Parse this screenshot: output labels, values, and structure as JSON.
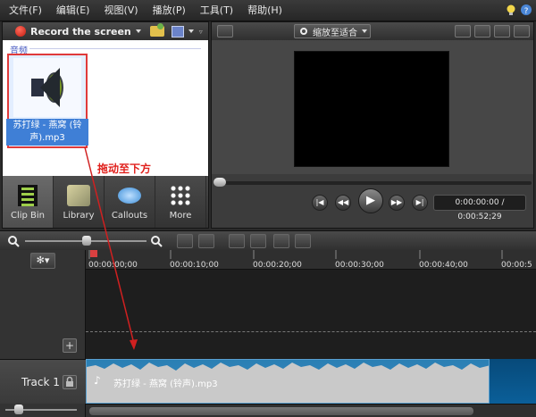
{
  "menu": [
    "文件(F)",
    "编辑(E)",
    "视图(V)",
    "播放(P)",
    "工具(T)",
    "帮助(H)"
  ],
  "clip_bin": {
    "record_label": "Record the screen",
    "section_label": "音频",
    "clip_name": "苏打绿 - 燕窝 (铃声).mp3",
    "tabs": [
      "Clip Bin",
      "Library",
      "Callouts",
      "More"
    ]
  },
  "preview": {
    "zoom_label": "缩放至适合",
    "timecode": "0:00:00:00 / 0:00:52;29"
  },
  "timeline": {
    "ruler_ticks": [
      "00:00:00;00",
      "00:00:10;00",
      "00:00:20;00",
      "00:00:30;00",
      "00:00:40;00",
      "00:00:5"
    ],
    "add_track": "+",
    "track_name": "Track 1",
    "audio_clip_name": "苏打绿 - 燕窝 (铃声).mp3"
  },
  "annotation": "拖动至下方",
  "colors": {
    "accent": "#e03a3a",
    "selection": "#3f7fd6",
    "clip": "#2a7fb4",
    "annotation": "#e0201c"
  }
}
